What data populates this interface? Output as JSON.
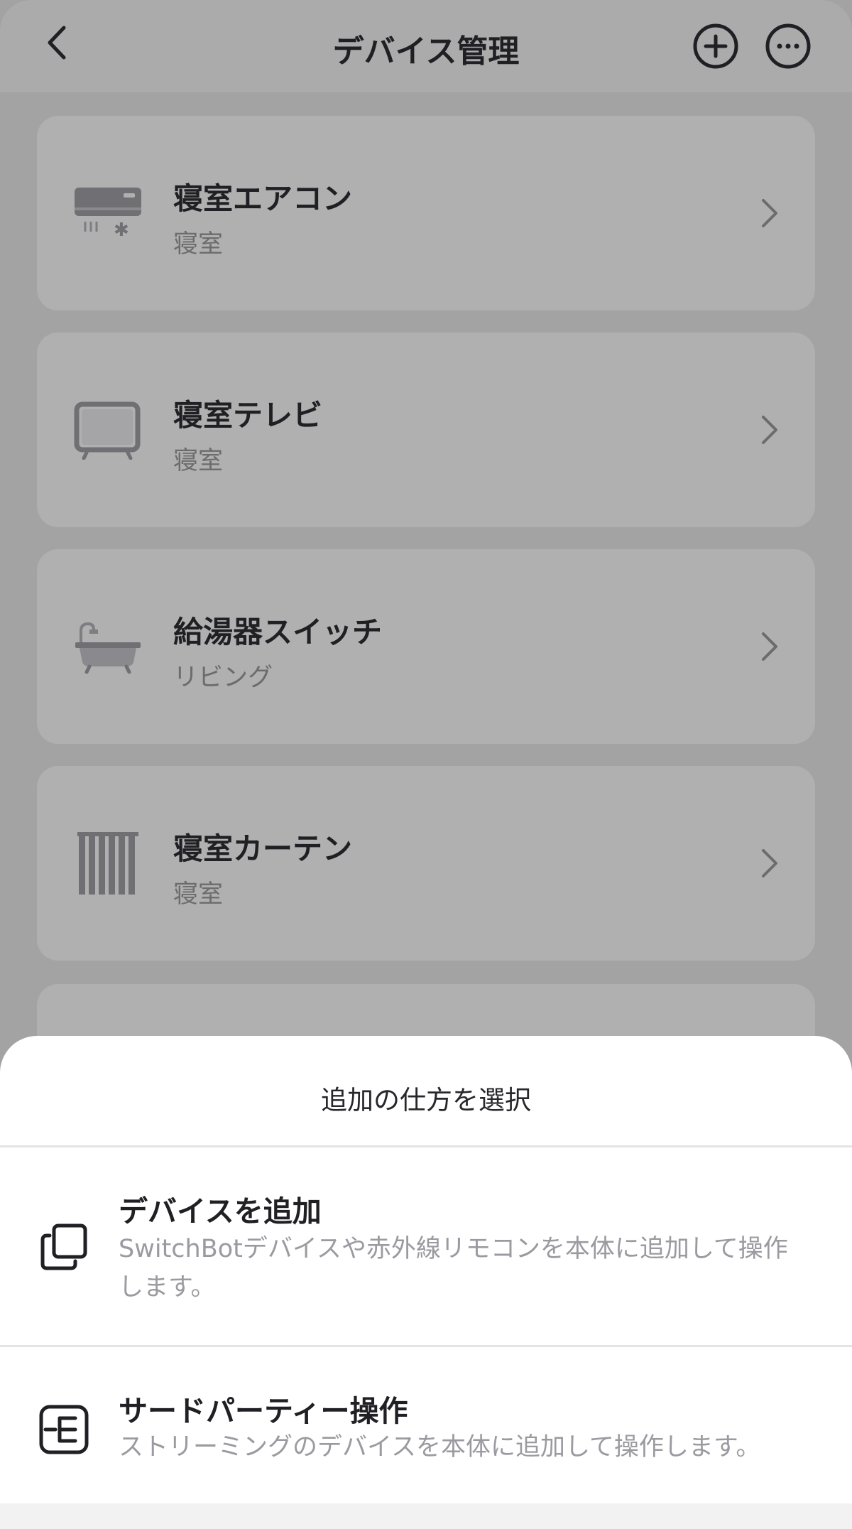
{
  "header": {
    "title": "デバイス管理",
    "back_icon": "chevron-left-icon",
    "add_icon": "plus-circle-icon",
    "more_icon": "more-horizontal-icon"
  },
  "devices": [
    {
      "name": "寝室エアコン",
      "room": "寝室",
      "icon": "air-conditioner-icon"
    },
    {
      "name": "寝室テレビ",
      "room": "寝室",
      "icon": "tv-icon"
    },
    {
      "name": "給湯器スイッチ",
      "room": "リビング",
      "icon": "bathtub-icon"
    },
    {
      "name": "寝室カーテン",
      "room": "寝室",
      "icon": "curtain-icon"
    }
  ],
  "sheet": {
    "title": "追加の仕方を選択",
    "options": [
      {
        "title": "デバイスを追加",
        "description": "SwitchBotデバイスや赤外線リモコンを本体に追加して操作します。",
        "icon": "copy-icon"
      },
      {
        "title": "サードパーティー操作",
        "description": "ストリーミングのデバイスを本体に追加して操作します。",
        "icon": "third-party-icon"
      }
    ]
  },
  "colors": {
    "overlay_background": "#a3a3a3",
    "card_background": "#b0b0b0",
    "sheet_background": "#ffffff",
    "text_primary": "#1f1f24",
    "text_secondary": "#9a9aa0"
  }
}
